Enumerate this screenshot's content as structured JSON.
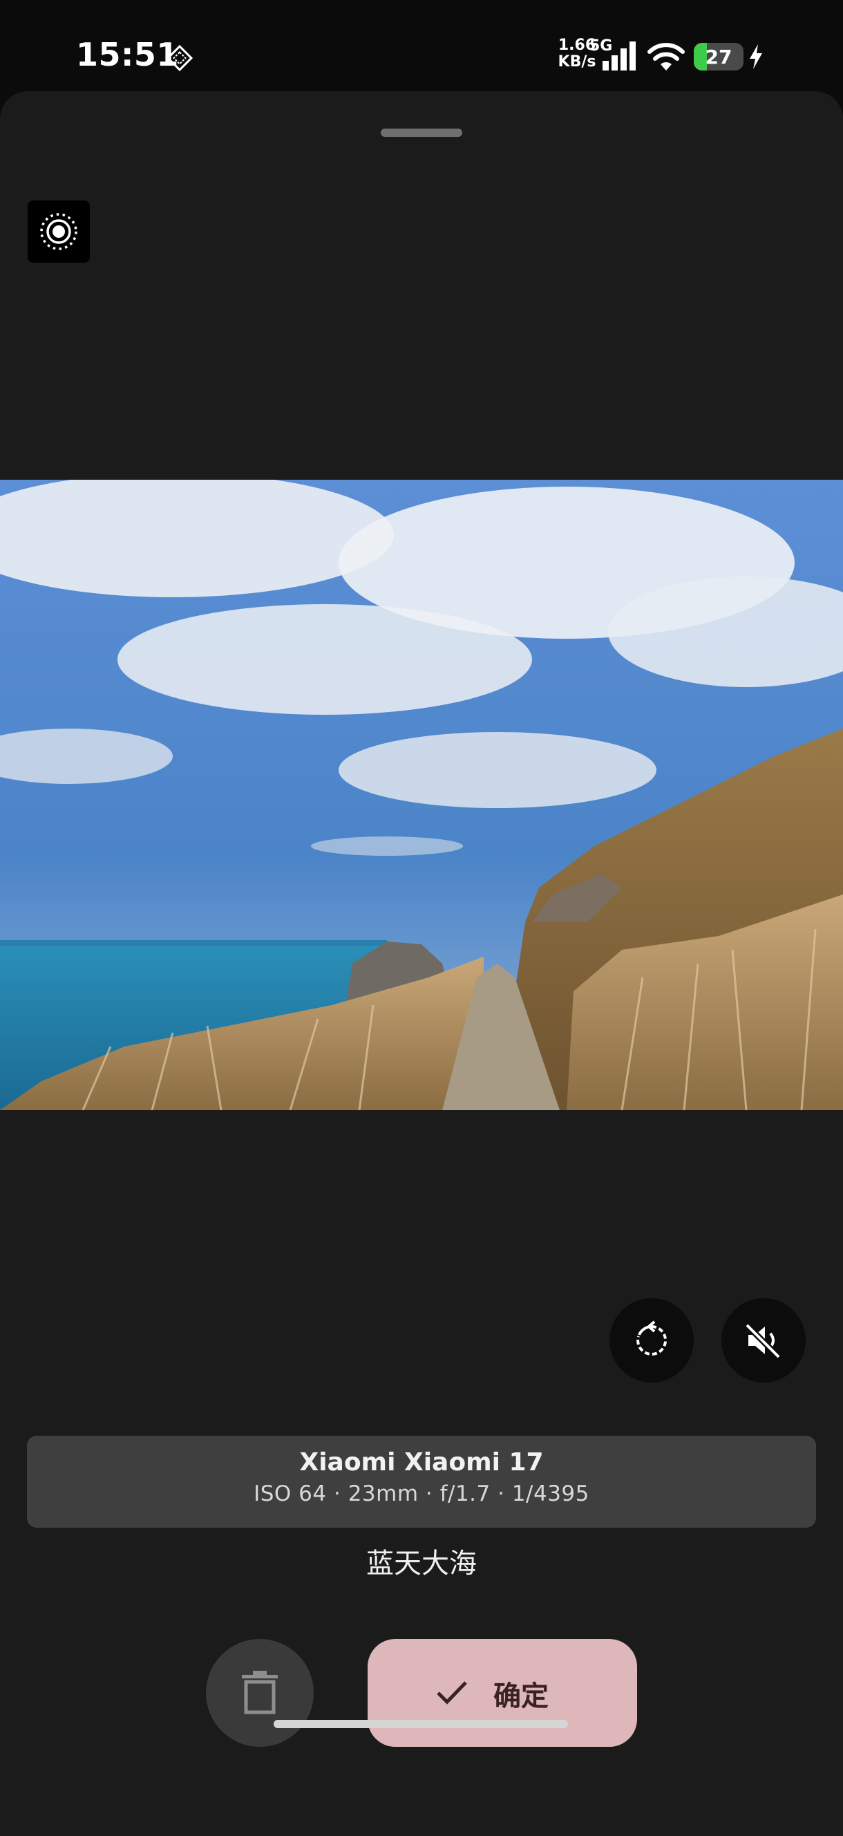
{
  "status_bar": {
    "time": "15:51",
    "net_speed_value": "1.66",
    "net_speed_unit": "KB/s",
    "network_type": "5G",
    "battery_level": "27",
    "battery_fraction": 0.27,
    "icons": [
      "diamond-notification-icon",
      "signal-icon",
      "wifi-icon",
      "battery-icon",
      "charging-bolt-icon"
    ]
  },
  "toolbar": {
    "settings_icon": "live-photo-settings-icon"
  },
  "photo": {
    "description_icon": "landscape-photo"
  },
  "controls": {
    "replay_icon": "replay-icon",
    "mute_icon": "volume-muted-icon"
  },
  "exif": {
    "camera": "Xiaomi Xiaomi 17",
    "details": "ISO 64 · 23mm · f/1.7 · 1/4395"
  },
  "caption": "蓝天大海",
  "actions": {
    "delete_icon": "trash-icon",
    "confirm_icon": "check-icon",
    "confirm_label": "确定"
  },
  "colors": {
    "sheet_bg": "#1b1b1b",
    "card_bg": "#3f3f3f",
    "confirm_bg": "#ddb7b9",
    "battery_green": "#3ecb4b"
  }
}
